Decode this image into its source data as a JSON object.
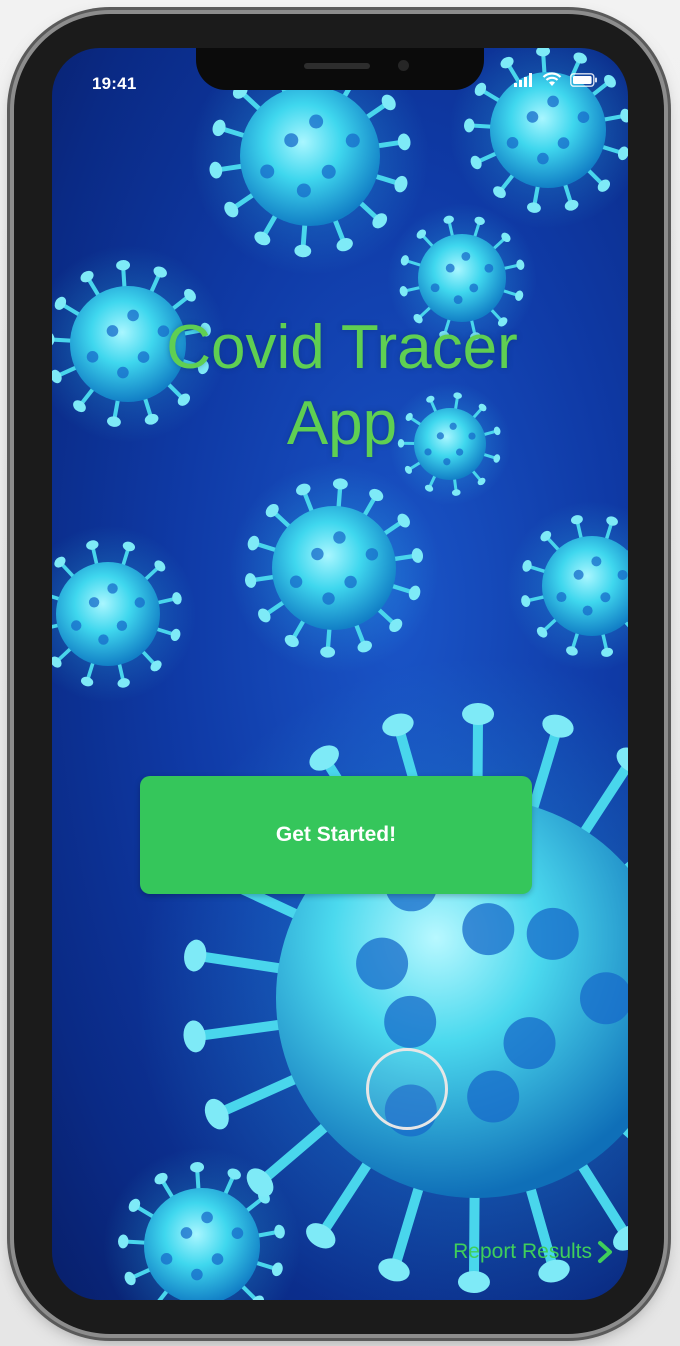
{
  "status_bar": {
    "time": "19:41",
    "icons": [
      "signal-icon",
      "wifi-icon",
      "battery-icon"
    ]
  },
  "hero": {
    "title_line1": "Covid Tracer",
    "title_line2": "App"
  },
  "actions": {
    "get_started_label": "Get Started!",
    "report_results_label": "Report Results"
  },
  "colors": {
    "title": "#5fcf52",
    "button": "#35c65b",
    "link": "#3fcf5a",
    "background": "#0f3aa6",
    "virus": "#4de3f0"
  }
}
